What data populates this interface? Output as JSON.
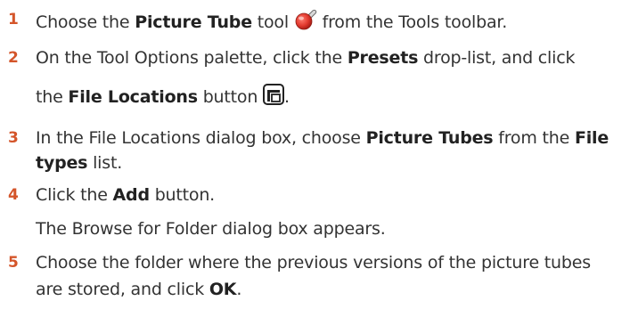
{
  "steps": [
    {
      "number": "1",
      "line1": {
        "a": "Choose the ",
        "b1": "Picture Tube",
        "c": " tool ",
        "d": " from the Tools toolbar."
      },
      "icon": "picture-tube-tool-icon"
    },
    {
      "number": "2",
      "line1": {
        "a": "On the Tool Options palette, click the ",
        "b1": "Presets",
        "c": " drop-list, and click"
      },
      "line2": {
        "a": "the ",
        "b1": "File Locations",
        "c": " button ",
        "d": "."
      },
      "icon": "file-locations-button-icon"
    },
    {
      "number": "3",
      "line1": {
        "a": "In the File Locations dialog box, choose ",
        "b1": "Picture Tubes",
        "c": " from the ",
        "b2": "File"
      },
      "line2": {
        "b1": "types",
        "c": " list."
      }
    },
    {
      "number": "4",
      "line1": {
        "a": "Click the ",
        "b1": "Add",
        "c": " button."
      },
      "line2": {
        "a": "The Browse for Folder dialog box appears."
      }
    },
    {
      "number": "5",
      "line1": {
        "a": "Choose the folder where the previous versions of the picture tubes"
      },
      "line2": {
        "a": "are stored, and click ",
        "b1": "OK",
        "c": "."
      }
    }
  ],
  "colors": {
    "step_number": "#d4552a",
    "text": "#333333",
    "icon_red": "#e23a2f"
  }
}
